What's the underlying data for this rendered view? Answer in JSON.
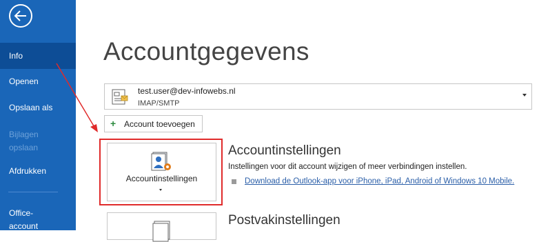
{
  "sidebar": {
    "items": [
      {
        "label": "Info"
      },
      {
        "label": "Openen"
      },
      {
        "label": "Opslaan als"
      },
      {
        "label": "Bijlagen opslaan"
      },
      {
        "label": "Afdrukken"
      },
      {
        "label": "Office-account"
      }
    ]
  },
  "main": {
    "title": "Accountgegevens",
    "account": {
      "email": "test.user@dev-infowebs.nl",
      "type": "IMAP/SMTP"
    },
    "add_account_label": "Account toevoegen",
    "account_settings": {
      "button_label": "Accountinstellingen",
      "title": "Accountinstellingen",
      "description": "Instellingen voor dit account wijzigen of meer verbindingen instellen.",
      "link": "Download de Outlook-app voor iPhone, iPad, Android of Windows 10 Mobile."
    },
    "mailbox_settings": {
      "title": "Postvakinstellingen"
    }
  },
  "colors": {
    "sidebar_bg": "#1a66b8",
    "sidebar_active": "#0d4d96",
    "highlight_border": "#e02a2a",
    "link": "#2a5ea8"
  },
  "icons": [
    "back-arrow-icon",
    "account-card-icon",
    "plus-icon",
    "account-settings-icon",
    "mailbox-icon"
  ]
}
